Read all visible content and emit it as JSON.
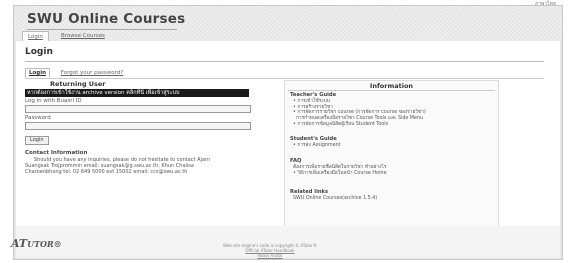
{
  "header": {
    "site_title": "SWU Online Courses",
    "language_link": "ภาษาไทย",
    "nav_tabs": [
      "Login",
      "Browse Courses"
    ]
  },
  "page": {
    "heading": "Login",
    "sub_tabs": [
      "Login",
      "Forgot your password?"
    ]
  },
  "returning_user": {
    "title": "Returning User",
    "archive_notice": "หากต้องการเข้าใช้งาน archive version คลิกที่นี่ เพื่อเข้าสู่ระบบ",
    "login_label": "Log in with Buasri ID",
    "login_value": "",
    "password_label": "Password",
    "password_value": "",
    "login_button": "Login"
  },
  "contact": {
    "title": "Contact Information",
    "line1": "Should you have any inquiries, please do not hesitate to contact Ajarn",
    "line2": "Suangsak Trojprommin email: suangsak@g.swu.ac.th, Khun Chalisa",
    "line3": "Charoenbhong tel. 02 649 5000 ext 15002 email: ccs@swu.ac.th"
  },
  "information": {
    "title": "Information",
    "teachers_guide": {
      "title": "Teacher's Guide",
      "items": [
        "• การเข้าใช้ระบบ",
        "• การสร้างรายวิชา",
        "• การจัดการรายวิชา course (การจัดการ course ของรายวิชา)",
        "การกำหนดเครื่องมือรายวิชา Course Tools และ Side Menu",
        "• การจัดการข้อมูลนิสิตผู้เรียน Student Tools"
      ]
    },
    "students_guide": {
      "title": "Student's Guide",
      "items": [
        "• การส่ง Assignment"
      ]
    },
    "faq": {
      "title": "FAQ",
      "items": [
        "ต้องการเพิ่มรายชื่อนิสิตในรายวิชา ทำอย่างไร",
        "• วิธีการเพิ่มเครื่องมือในหน้า Course Home"
      ]
    },
    "related_links": {
      "title": "Related links",
      "items": [
        "SWU Online Courses(archive 1.5.4)"
      ]
    }
  },
  "footer": {
    "logo_main": "AT",
    "logo_rest": "UTOR",
    "logo_mark": "®",
    "line1": "Web site engine's code is copyright © ATutor®",
    "line2": "Official ATutor Handbook",
    "about_link": "About ATutor"
  }
}
